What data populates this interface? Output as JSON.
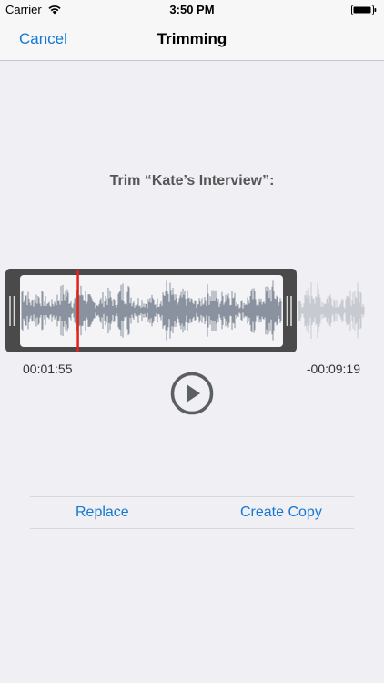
{
  "status_bar": {
    "carrier": "Carrier",
    "time": "3:50 PM",
    "icons": [
      "wifi-icon",
      "battery-icon"
    ]
  },
  "nav": {
    "cancel_label": "Cancel",
    "title": "Trimming"
  },
  "prompt": "Trim “Kate’s Interview”:",
  "trim": {
    "start_time": "00:01:55",
    "end_time": "-00:09:19",
    "playhead_fraction": 0.22
  },
  "player": {
    "play_icon": "play-icon"
  },
  "actions": {
    "replace_label": "Replace",
    "copy_label": "Create Copy"
  },
  "colors": {
    "accent": "#1478d4",
    "selection_frame": "#4a4a4a",
    "playhead": "#e0241b",
    "waveform": "#7e8796",
    "waveform_dim": "#c3c6ce",
    "background": "#efeff4"
  }
}
